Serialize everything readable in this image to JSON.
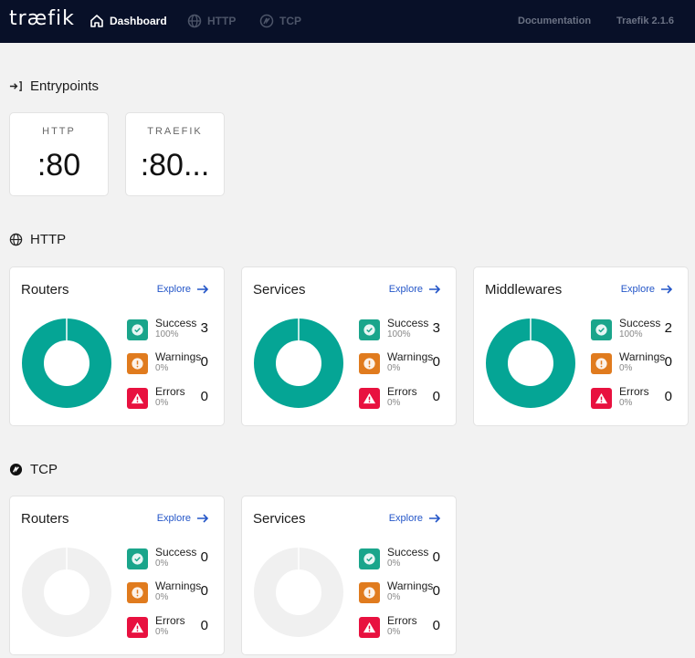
{
  "nav": {
    "logo": "træfik",
    "items": [
      {
        "label": "Dashboard",
        "active": true
      },
      {
        "label": "HTTP",
        "active": false
      },
      {
        "label": "TCP",
        "active": false
      }
    ],
    "documentation": "Documentation",
    "version": "Traefik 2.1.6"
  },
  "entrypoints": {
    "title": "Entrypoints",
    "items": [
      {
        "name": "HTTP",
        "port": ":80"
      },
      {
        "name": "TRAEFIK",
        "port": ":80..."
      }
    ]
  },
  "http": {
    "title": "HTTP",
    "cards": [
      {
        "title": "Routers",
        "explore": "Explore",
        "success": {
          "label": "Success",
          "pct": "100%",
          "count": "3"
        },
        "warnings": {
          "label": "Warnings",
          "pct": "0%",
          "count": "0"
        },
        "errors": {
          "label": "Errors",
          "pct": "0%",
          "count": "0"
        }
      },
      {
        "title": "Services",
        "explore": "Explore",
        "success": {
          "label": "Success",
          "pct": "100%",
          "count": "3"
        },
        "warnings": {
          "label": "Warnings",
          "pct": "0%",
          "count": "0"
        },
        "errors": {
          "label": "Errors",
          "pct": "0%",
          "count": "0"
        }
      },
      {
        "title": "Middlewares",
        "explore": "Explore",
        "success": {
          "label": "Success",
          "pct": "100%",
          "count": "2"
        },
        "warnings": {
          "label": "Warnings",
          "pct": "0%",
          "count": "0"
        },
        "errors": {
          "label": "Errors",
          "pct": "0%",
          "count": "0"
        }
      }
    ]
  },
  "tcp": {
    "title": "TCP",
    "cards": [
      {
        "title": "Routers",
        "explore": "Explore",
        "success": {
          "label": "Success",
          "pct": "0%",
          "count": "0"
        },
        "warnings": {
          "label": "Warnings",
          "pct": "0%",
          "count": "0"
        },
        "errors": {
          "label": "Errors",
          "pct": "0%",
          "count": "0"
        }
      },
      {
        "title": "Services",
        "explore": "Explore",
        "success": {
          "label": "Success",
          "pct": "0%",
          "count": "0"
        },
        "warnings": {
          "label": "Warnings",
          "pct": "0%",
          "count": "0"
        },
        "errors": {
          "label": "Errors",
          "pct": "0%",
          "count": "0"
        }
      }
    ]
  },
  "colors": {
    "topbar": "#081028",
    "success": "#1aa58b",
    "warning": "#e07b1e",
    "error": "#e8113f",
    "donut_full": "#05a595",
    "donut_empty": "#f0f0f0",
    "link": "#2456c8"
  }
}
